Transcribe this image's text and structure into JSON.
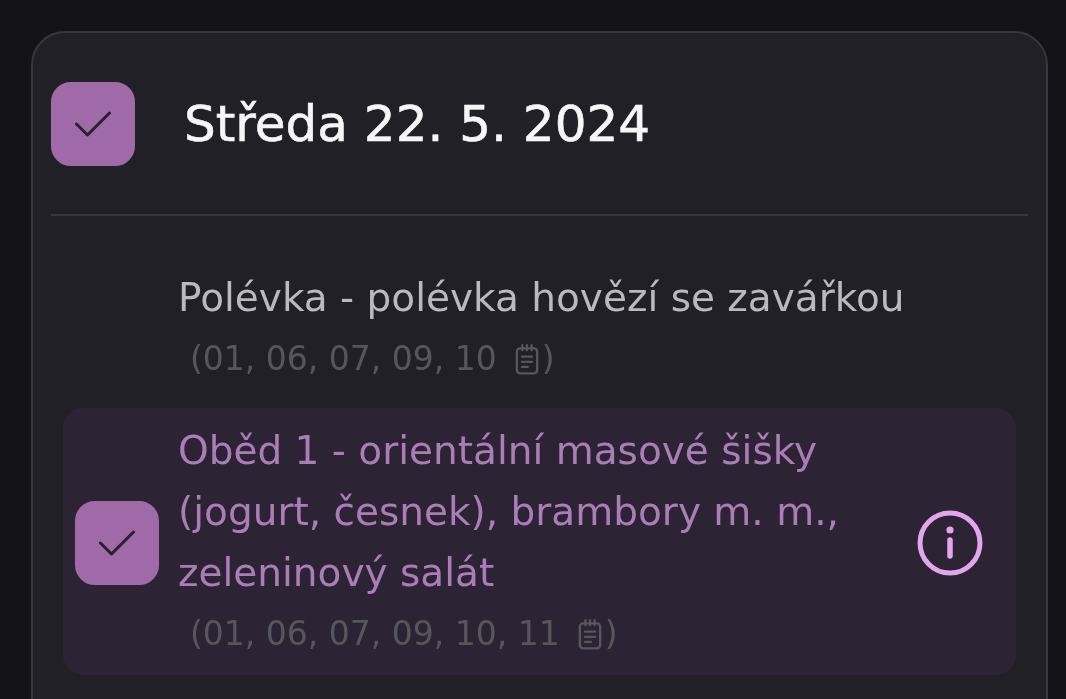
{
  "day_card": {
    "checked": true,
    "title": "Středa 22. 5. 2024",
    "meals": [
      {
        "kind": "soup",
        "selected": false,
        "name": "Polévka - polévka hovězí se zavářkou",
        "allergens": "(01, 06, 07, 09, 10",
        "allergens_close": ")"
      },
      {
        "kind": "choice",
        "selected": true,
        "name": "Oběd 1 - orientální masové šišky (jogurt, česnek), brambory m. m., zeleninový salát",
        "allergens": "(01, 06, 07, 09, 10, 11",
        "allergens_close": ")"
      }
    ]
  }
}
